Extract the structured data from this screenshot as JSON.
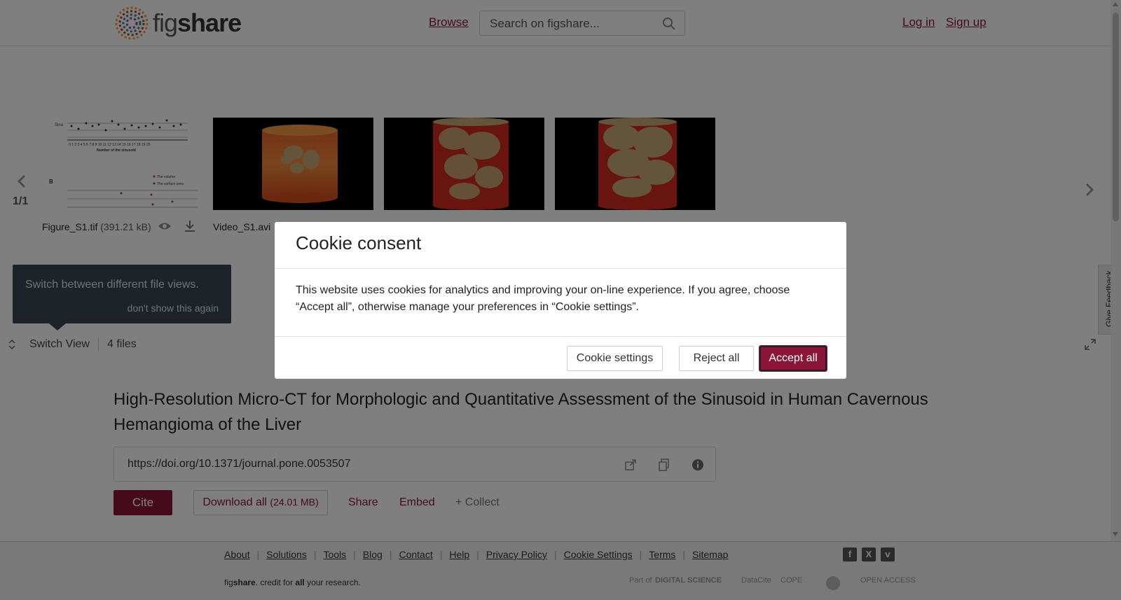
{
  "header": {
    "logo_text_light": "fig",
    "logo_text_bold": "share",
    "browse": "Browse",
    "search_placeholder": "Search on figshare...",
    "login": "Log in",
    "signup": "Sign up"
  },
  "carousel": {
    "page_count": "1/1",
    "files": [
      {
        "name": "Figure_S1.tif",
        "size": "(391.21 kB)"
      },
      {
        "name": "Video_S1.avi",
        "size": ""
      }
    ]
  },
  "tooltip": {
    "text": "Switch between different file views.",
    "dismiss": "don't show this again"
  },
  "switch_bar": {
    "switch_view": "Switch View",
    "files_count": "4 files"
  },
  "feedback": "Give Feedback",
  "article": {
    "title": "High-Resolution Micro-CT for Morphologic and Quantitative Assessment of the Sinusoid in Human Cavernous Hemangioma of the Liver",
    "doi": "https://doi.org/10.1371/journal.pone.0053507",
    "cite": "Cite",
    "download_all": "Download all",
    "download_size": "(24.01 MB)",
    "share": "Share",
    "embed": "Embed",
    "collect": "+ Collect"
  },
  "footer": {
    "links": [
      "About",
      "Solutions",
      "Tools",
      "Blog",
      "Contact",
      "Help",
      "Privacy Policy",
      "Cookie Settings",
      "Terms",
      "Sitemap"
    ],
    "tagline_fig": "fig",
    "tagline_share": "share",
    "tagline_mid": ". credit for ",
    "tagline_all": "all",
    "tagline_end": " your research.",
    "partner_part_of": "Part of",
    "partner_ds": "DIGITAL SCIENCE",
    "partner_datacite": "DataCite",
    "partner_cope": "COPE",
    "partner_oa": "OPEN ACCESS"
  },
  "modal": {
    "title": "Cookie consent",
    "body": "This website uses cookies for analytics and improving your on-line experience. If you agree, choose “Accept all”, otherwise manage your preferences in “Cookie settings”.",
    "cookie_settings": "Cookie settings",
    "reject_all": "Reject all",
    "accept_all": "Accept all"
  },
  "colors": {
    "brand": "#8a1538",
    "tooltip_bg": "#3a4652"
  }
}
